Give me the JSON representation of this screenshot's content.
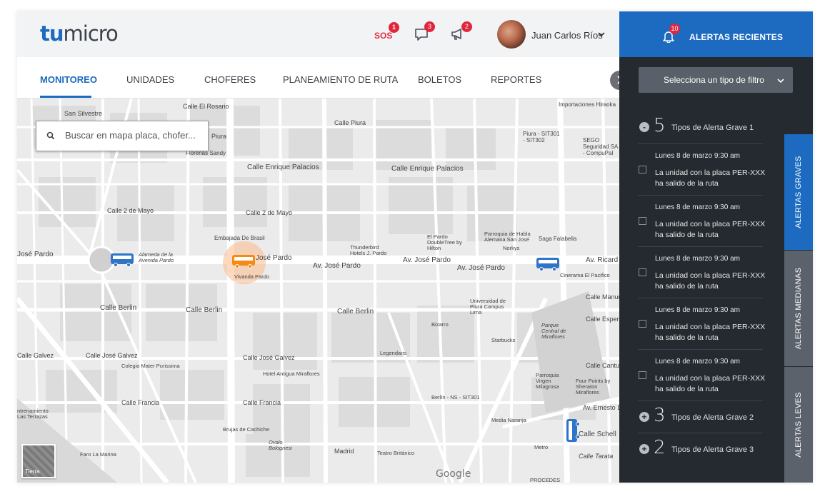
{
  "header": {
    "logo_tu": "tu",
    "logo_micro": "micro",
    "sos_label": "SOS",
    "sos_badge": "1",
    "messages_badge": "3",
    "announcements_badge": "2",
    "user_name": "Juan Carlos Ríos"
  },
  "nav": {
    "tabs": [
      {
        "label": "MONITOREO"
      },
      {
        "label": "UNIDADES"
      },
      {
        "label": "CHOFERES"
      },
      {
        "label": "PLANEAMIENTO DE RUTA"
      },
      {
        "label": "BOLETOS"
      },
      {
        "label": "REPORTES"
      }
    ]
  },
  "map": {
    "search_placeholder": "Buscar en mapa placa, chofer...",
    "tierra_label": "Tierra",
    "google_label": "Google",
    "labels": {
      "san_silvestre": "San Silvestre",
      "calle_el_rosario": "Calle El Rosario",
      "importaciones": "Importaciones Hiraoka",
      "calle_piura": "Calle Piura",
      "piura": "Piura",
      "piura_sit": "Piura - SIT301 - SIT302",
      "sego": "SEGO Seguridad SA - CompuPal",
      "florerias": "Florerias Sandy",
      "enrique_palacios_1": "Calle Enrique Palacios",
      "enrique_palacios_2": "Calle Enrique Palacios",
      "dos_de_mayo_1": "Calle 2 de Mayo",
      "dos_de_mayo_2": "Calle 2 de Mayo",
      "embajada": "Embajada De Brasil",
      "thunderbird": "Thunderbird Hotels J. Pardo",
      "el_pardo": "El Pardo DoubleTree by Hilton",
      "parroquia_habla": "Parroquia de Habla Alemana San José",
      "norkys": "Norkys",
      "saga": "Saga Falabella",
      "jose_pardo_left": "José Pardo",
      "alameda": "Alameda de la Avenida Pardo",
      "jose_pardo_1": "José Pardo",
      "av_jose_pardo_1": "Av. José Pardo",
      "av_jose_pardo_2": "Av. José Pardo",
      "av_jose_pardo_3": "Av. José Pardo",
      "av_ricardo": "Av. Ricard",
      "vivanda": "Vivanda Pardo",
      "cinerama": "Cinerama El Pacifico",
      "calle_berlin_1": "Calle Berlin",
      "calle_berlin_2": "Calle Berlin",
      "calle_berlin_3": "Calle Berlin",
      "calle_manuel": "Calle Manue",
      "universidad": "Universidad de Piura Campus Lima",
      "bizarro": "Bizarro",
      "starbucks": "Starbucks",
      "parque_central": "Parque Central de Miraflores",
      "calle_espera": "Calle Espera",
      "calle_galvez_1": "Calle José Galvez",
      "calle_galvez_2": "Calle José Galvez",
      "calle_galvez_left": "Calle Galvez",
      "colegio": "Colegio Mater Purissima",
      "legendaris": "Legendaris",
      "hotel_antigua": "Hotel Antigua Miraflores",
      "parroquia_virgen": "Parroquia Virgen Milagrosa",
      "four_points": "Four Points by Sheraton Miraflores",
      "calle_cantuar": "Calle Cantuar",
      "berlin_ns": "Berlín - NS - SIT301",
      "calle_francia_1": "Calle Francia",
      "calle_francia_2": "Calle Francia",
      "av_ernesto": "Av. Ernesto Di",
      "media_naranja": "Media Naranja",
      "entrenamiento": "ntrenamiento Las Terrazas",
      "brujas": "Brujas de Cachiche",
      "ovalo": "Ovalo Bolognesi",
      "madrid": "Madrid",
      "teatro": "Teatro Británico",
      "metro": "Metro",
      "calle_schell": "Calle Schell",
      "calle_tarata": "Calle Tarata",
      "faro": "Faro La Marina",
      "procedes": "PROCEDES"
    }
  },
  "panel": {
    "title": "ALERTAS RECIENTES",
    "bell_badge": "10",
    "filter_label": "Selecciona un tipo de filtro",
    "group1": {
      "toggle": "-",
      "count": "5",
      "label": "Tipos de Alerta Grave 1"
    },
    "alerts": [
      {
        "date": "Lunes 8 de marzo   9:30 am",
        "message": "La unidad con la placa PER-XXX ha salido de la ruta"
      },
      {
        "date": "Lunes 8 de marzo   9:30 am",
        "message": "La unidad con la placa PER-XXX ha salido de la ruta"
      },
      {
        "date": "Lunes 8 de marzo   9:30 am",
        "message": "La unidad con la placa PER-XXX ha salido de la ruta"
      },
      {
        "date": "Lunes 8 de marzo   9:30 am",
        "message": "La unidad con la placa PER-XXX ha salido de la ruta"
      },
      {
        "date": "Lunes 8 de marzo   9:30 am",
        "message": "La unidad con la placa PER-XXX ha salido de la ruta"
      }
    ],
    "group2": {
      "toggle": "+",
      "count": "3",
      "label": "Tipos de Alerta Grave 2"
    },
    "group3": {
      "toggle": "+",
      "count": "2",
      "label": "Tipos de Alerta Grave 3"
    },
    "vertical_tabs": {
      "graves": "ALERTAS GRAVES",
      "medianas": "ALERTAS MEDIANAS",
      "leves": "ALERTAS LEVES"
    }
  },
  "colors": {
    "brand_blue": "#1c6bc0",
    "panel_dark": "#252a30",
    "badge_red": "#e0263c",
    "bus_orange": "#f58a14",
    "bus_blue": "#2f74c7"
  },
  "icons": {
    "search": "search-icon",
    "chat": "chat-icon",
    "megaphone": "megaphone-icon",
    "bell": "bell-icon",
    "chevron_down": "chevron-down-icon",
    "chevron_right": "chevron-right-icon",
    "bus": "bus-icon"
  }
}
